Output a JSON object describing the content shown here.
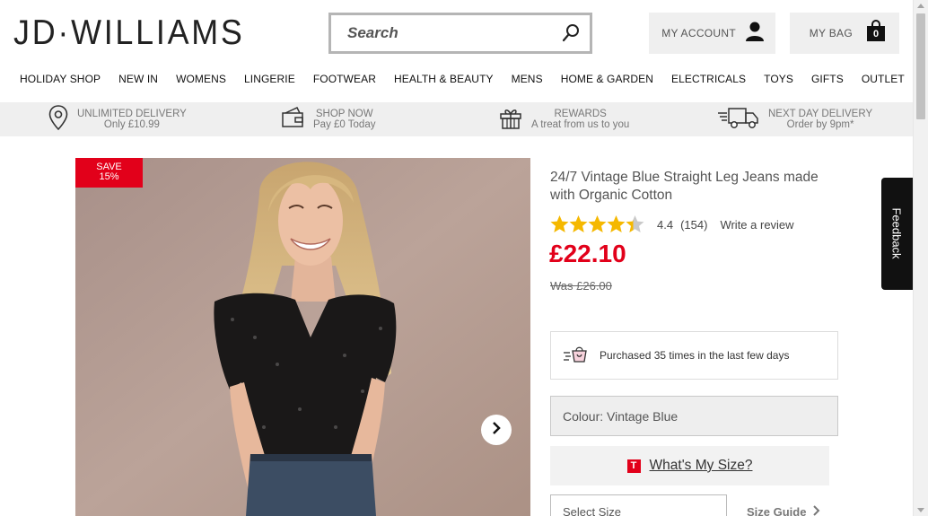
{
  "header": {
    "logo": "JD·WILLIAMS",
    "search_placeholder": "Search",
    "account_label": "MY ACCOUNT",
    "bag_label": "MY BAG",
    "bag_count": "0"
  },
  "nav": [
    "HOLIDAY SHOP",
    "NEW IN",
    "WOMENS",
    "LINGERIE",
    "FOOTWEAR",
    "HEALTH & BEAUTY",
    "MENS",
    "HOME & GARDEN",
    "ELECTRICALS",
    "TOYS",
    "GIFTS",
    "OUTLET"
  ],
  "usp": [
    {
      "title": "UNLIMITED DELIVERY",
      "sub": "Only £10.99",
      "icon": "location-pin-icon"
    },
    {
      "title": "SHOP NOW",
      "sub": "Pay £0 Today",
      "icon": "wallet-icon"
    },
    {
      "title": "REWARDS",
      "sub": "A treat from us to you",
      "icon": "gift-icon"
    },
    {
      "title": "NEXT DAY DELIVERY",
      "sub": "Order by 9pm*",
      "icon": "delivery-truck-icon"
    }
  ],
  "product": {
    "save_badge_line1": "SAVE",
    "save_badge_line2": "15%",
    "title": "24/7 Vintage Blue Straight Leg Jeans made with Organic Cotton",
    "rating": 4.4,
    "rating_text": "4.4",
    "review_count": "(154)",
    "write_review": "Write a review",
    "price": "£22.10",
    "was_price": "Was £26.00",
    "purchased_text": "Purchased 35 times in the last few days",
    "colour": "Colour: Vintage Blue",
    "size_help": "What's My Size?",
    "size_help_icon_letter": "T",
    "select_size": "Select Size",
    "size_guide": "Size Guide"
  },
  "feedback_label": "Feedback",
  "colors": {
    "accent_red": "#e2001a",
    "star_gold": "#f5b800",
    "panel_grey": "#efefef"
  }
}
